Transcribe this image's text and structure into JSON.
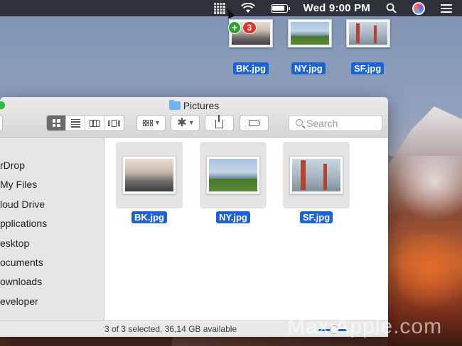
{
  "menubar": {
    "clock": "Wed 9:00 PM",
    "icons": [
      "grid-icon",
      "wifi-icon",
      "battery-icon",
      "search-icon",
      "siri-icon",
      "menu-list-icon"
    ]
  },
  "drag": {
    "items": [
      {
        "label": "BK.jpg",
        "photo": "skyline-haze"
      },
      {
        "label": "NY.jpg",
        "photo": "park-skyline"
      },
      {
        "label": "SF.jpg",
        "photo": "golden-gate-bridge"
      }
    ],
    "plus": "+",
    "count": "3"
  },
  "window": {
    "title": "Pictures",
    "search_placeholder": "Search"
  },
  "sidebar": {
    "header": "s",
    "items": [
      {
        "label": "rDrop"
      },
      {
        "label": "My Files"
      },
      {
        "label": "loud Drive"
      },
      {
        "label": "pplications"
      },
      {
        "label": "esktop"
      },
      {
        "label": "ocuments"
      },
      {
        "label": "ownloads"
      },
      {
        "label": "eveloper"
      }
    ]
  },
  "files": [
    {
      "name": "BK.jpg",
      "photo": "skyline-haze"
    },
    {
      "name": "NY.jpg",
      "photo": "park-skyline"
    },
    {
      "name": "SF.jpg",
      "photo": "golden-gate-bridge"
    }
  ],
  "status": {
    "text": "3 of 3 selected, 36,14 GB available",
    "icon_size_fraction": 0.55
  },
  "watermark": "MaxiApple.com",
  "colors": {
    "selection": "#1b62d6",
    "badge_green": "#2aa52a",
    "badge_red": "#e1332e",
    "folder": "#6fb4ee"
  }
}
